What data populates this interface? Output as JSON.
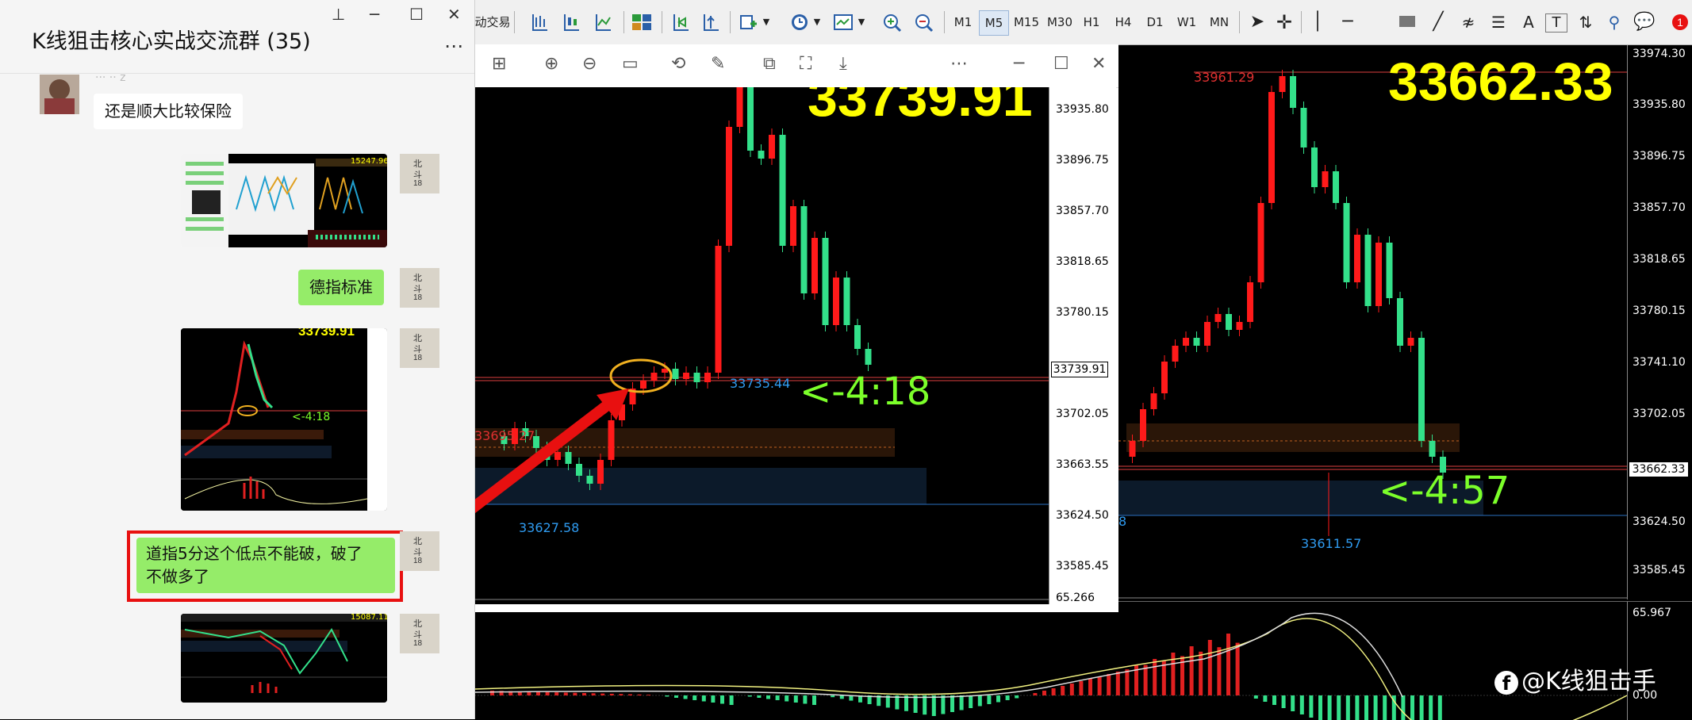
{
  "chat": {
    "title": "K线狙击核心实战交流群 (35)",
    "msg1_sender": "··· ·· z",
    "msg1": "还是顺大比较保险",
    "msg2": "德指标准",
    "msg3": "道指5分这个低点不能破，破了\n不做多了"
  },
  "thumb1": {
    "price": "15247.96"
  },
  "thumb2": {
    "price": "33739.91",
    "timer": "<-4:18"
  },
  "thumb3": {
    "price": "15087.11"
  },
  "avatar_chars": [
    "北",
    "斗",
    "18"
  ],
  "toolbar": {
    "trade_label": "动交易",
    "timeframes": [
      "M1",
      "M5",
      "M15",
      "M30",
      "H1",
      "H4",
      "D1",
      "W1",
      "MN"
    ],
    "notification_count": "1"
  },
  "chart_popup": {
    "big_price": "33739.91",
    "timer": "<-4:18",
    "label_high": "33735.44",
    "label_left": "33695.27",
    "label_low": "33627.58",
    "current_price": "33739.91",
    "scale": [
      "33935.80",
      "33896.75",
      "33857.70",
      "33818.65",
      "33780.15",
      "33702.05",
      "33663.55",
      "33624.50",
      "33585.45",
      "65.266"
    ]
  },
  "main_chart": {
    "big_price": "33662.33",
    "timer": "<-4:57",
    "label_high": "33961.29",
    "label_low": "33611.57",
    "label_left": "8",
    "current_price": "33662.33",
    "scale": [
      "33974.30",
      "33935.80",
      "33896.75",
      "33857.70",
      "33818.65",
      "33780.15",
      "33741.10",
      "33702.05",
      "33624.50",
      "33585.45"
    ],
    "indicator_top": "65.967",
    "indicator_zero": "0.00"
  },
  "watermark": "@K线狙击手",
  "colors": {
    "up": "#ff1a1a",
    "down": "#33e08a",
    "price_yellow": "#ffff00",
    "timer_green": "#7cff2a",
    "label_blue": "#2f9bf0",
    "label_red": "#e03030",
    "highlight": "#e81010",
    "bubble_green": "#95ec69"
  }
}
